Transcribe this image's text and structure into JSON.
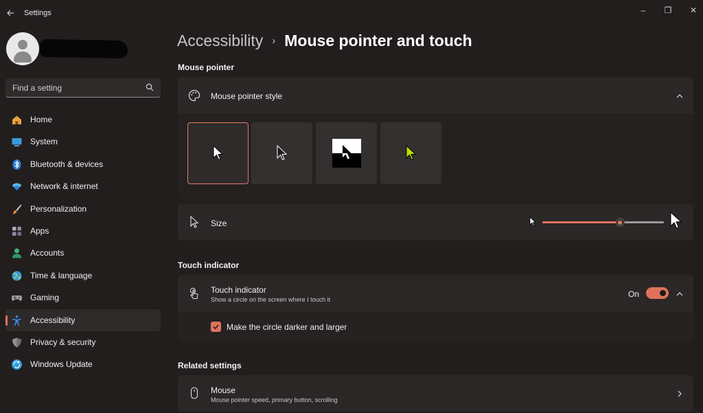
{
  "window": {
    "app_title": "Settings",
    "controls": {
      "minimize": "–",
      "restore": "❐",
      "close": "✕"
    }
  },
  "sidebar": {
    "search_placeholder": "Find a setting",
    "items": [
      {
        "label": "Home",
        "icon": "home-icon",
        "color": "#e8a33d"
      },
      {
        "label": "System",
        "icon": "system-icon",
        "color": "#3a9ad9"
      },
      {
        "label": "Bluetooth & devices",
        "icon": "bluetooth-icon",
        "color": "#2f80d8"
      },
      {
        "label": "Network & internet",
        "icon": "network-icon",
        "color": "#5bb8e6"
      },
      {
        "label": "Personalization",
        "icon": "brush-icon",
        "color": "#e88a3a"
      },
      {
        "label": "Apps",
        "icon": "apps-icon",
        "color": "#8a8fa6"
      },
      {
        "label": "Accounts",
        "icon": "accounts-icon",
        "color": "#3fb37f"
      },
      {
        "label": "Time & language",
        "icon": "globe-icon",
        "color": "#3a9ad9"
      },
      {
        "label": "Gaming",
        "icon": "gamepad-icon",
        "color": "#9a9a9a"
      },
      {
        "label": "Accessibility",
        "icon": "accessibility-icon",
        "color": "#3a86e0",
        "active": true
      },
      {
        "label": "Privacy & security",
        "icon": "shield-icon",
        "color": "#8f8f8f"
      },
      {
        "label": "Windows Update",
        "icon": "update-icon",
        "color": "#2f9ad8"
      }
    ]
  },
  "breadcrumb": {
    "parent": "Accessibility",
    "separator": "›",
    "current": "Mouse pointer and touch"
  },
  "mouse_pointer": {
    "section_title": "Mouse pointer",
    "style_card_title": "Mouse pointer style",
    "styles": [
      {
        "name": "white",
        "selected": true
      },
      {
        "name": "black",
        "selected": false
      },
      {
        "name": "inverted",
        "selected": false
      },
      {
        "name": "custom",
        "selected": false,
        "color": "#b6e000"
      }
    ],
    "size_label": "Size",
    "size_value": 0.64
  },
  "touch": {
    "section_title": "Touch indicator",
    "card_title": "Touch indicator",
    "card_subtitle": "Show a circle on the screen where I touch it",
    "toggle_label": "On",
    "toggle_on": true,
    "checkbox_label": "Make the circle darker and larger",
    "checkbox_checked": true
  },
  "related": {
    "section_title": "Related settings",
    "mouse_title": "Mouse",
    "mouse_subtitle": "Mouse pointer speed, primary button, scrolling"
  },
  "colors": {
    "accent": "#e0715d",
    "background": "#221e1e",
    "card": "#2b2727"
  }
}
